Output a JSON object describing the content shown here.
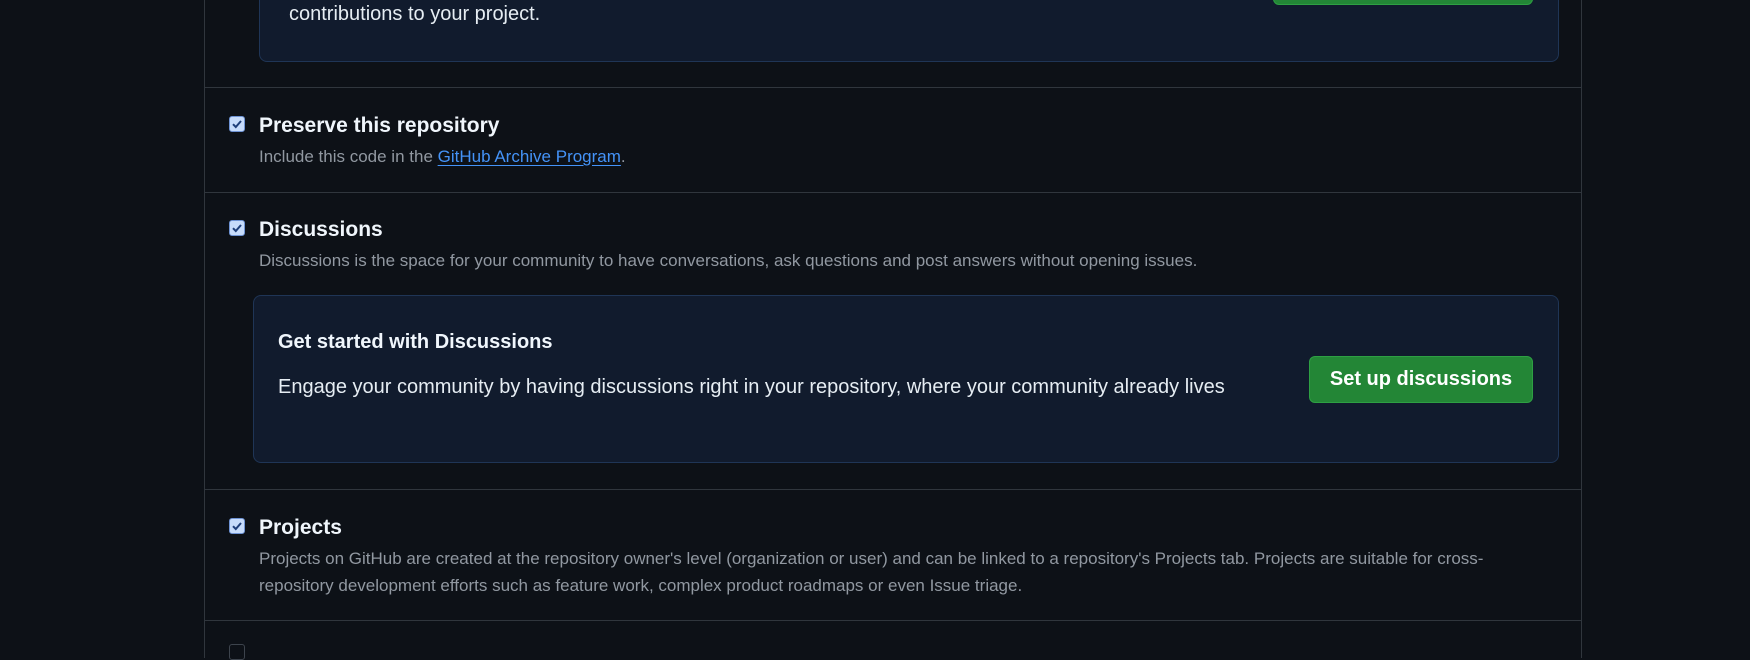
{
  "top_callout": {
    "text": "contributions to your project."
  },
  "settings": {
    "preserve": {
      "title": "Preserve this repository",
      "desc_prefix": "Include this code in the ",
      "link": "GitHub Archive Program",
      "desc_suffix": ".",
      "checked": true
    },
    "discussions": {
      "title": "Discussions",
      "desc": "Discussions is the space for your community to have conversations, ask questions and post answers without opening issues.",
      "checked": true,
      "callout": {
        "title": "Get started with Discussions",
        "body": "Engage your community by having discussions right in your repository, where your community already lives",
        "button": "Set up discussions"
      }
    },
    "projects": {
      "title": "Projects",
      "desc": "Projects on GitHub are created at the repository owner's level (organization or user) and can be linked to a repository's Projects tab. Projects are suitable for cross-repository development efforts such as feature work, complex product roadmaps or even Issue triage.",
      "checked": true
    }
  },
  "colors": {
    "background": "#0d1117",
    "callout_bg": "#111b2d",
    "button_green": "#238636",
    "link_blue": "#4493f8",
    "checkbox_fill": "#c7dcfb"
  }
}
